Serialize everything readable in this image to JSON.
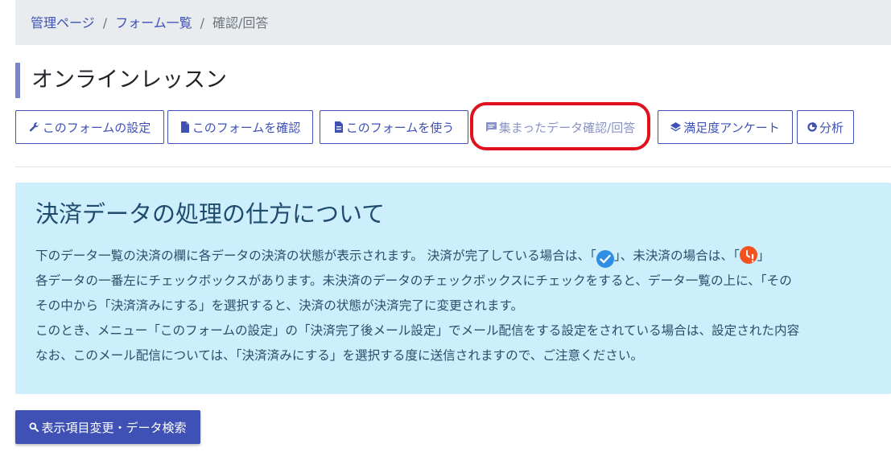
{
  "breadcrumb": {
    "items": [
      "管理ページ",
      "フォーム一覧"
    ],
    "current": "確認/回答",
    "separator": "/"
  },
  "page": {
    "title": "オンラインレッスン"
  },
  "toolbar": {
    "form_settings": "このフォームの設定",
    "check_form": "このフォームを確認",
    "use_form": "このフォームを使う",
    "collected_data": "集まったデータ確認/回答",
    "satisfaction_survey": "満足度アンケート",
    "analysis": "分析"
  },
  "info": {
    "title": "決済データの処理の仕方について",
    "line1_a": "下のデータ一覧の決済の欄に各データの決済の状態が表示されます。 決済が完了している場合は、「",
    "line1_b": "」、未決済の場合は、「",
    "line1_c": "」",
    "line2": "各データの一番左にチェックボックスがあります。未決済のデータのチェックボックスにチェックをすると、データ一覧の上に、「その",
    "line3": "その中から「決済済みにする」を選択すると、決済の状態が決済完了に変更されます。",
    "line4": "このとき、メニュー「このフォームの設定」の「決済完了後メール設定」でメール配信をする設定をされている場合は、設定された内容",
    "line5": "なお、このメール配信については、「決済済みにする」を選択する度に送信されますので、ご注意ください。"
  },
  "search_button": {
    "label": "表示項目変更・データ検索"
  },
  "colors": {
    "primary": "#3f51b5",
    "highlight": "#e0101c",
    "info_bg": "#cdeefb",
    "paid_badge": "#2f8de4",
    "unpaid_badge": "#f4511e"
  },
  "icons": {
    "form_settings": "wrench-icon",
    "check_form": "document-icon",
    "use_form": "document-text-icon",
    "collected_data": "comment-icon",
    "satisfaction_survey": "layers-icon",
    "analysis": "pie-chart-icon",
    "search": "search-icon"
  }
}
